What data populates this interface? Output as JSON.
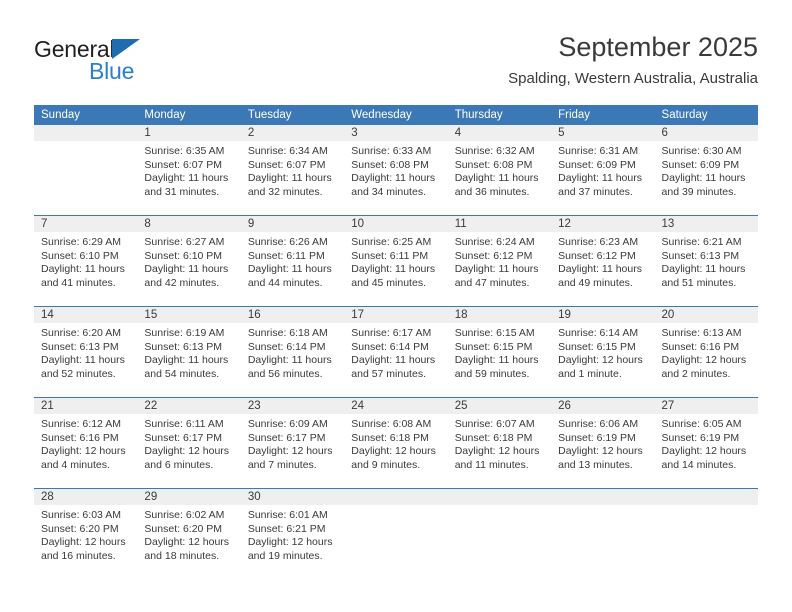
{
  "brand": {
    "name_dark": "General",
    "name_blue": "Blue",
    "triangle_icon": "blue-triangle-logo-mark",
    "accent_color": "#2980c9",
    "triangle_color": "#1f6cb0"
  },
  "header": {
    "title": "September 2025",
    "subtitle": "Spalding, Western Australia, Australia"
  },
  "calendar": {
    "header_color": "#3b78b5",
    "daynum_band_color": "#efefef",
    "weekdays": [
      "Sunday",
      "Monday",
      "Tuesday",
      "Wednesday",
      "Thursday",
      "Friday",
      "Saturday"
    ],
    "weeks": [
      [
        {
          "day": "",
          "lines": []
        },
        {
          "day": "1",
          "lines": [
            "Sunrise: 6:35 AM",
            "Sunset: 6:07 PM",
            "Daylight: 11 hours",
            "and 31 minutes."
          ]
        },
        {
          "day": "2",
          "lines": [
            "Sunrise: 6:34 AM",
            "Sunset: 6:07 PM",
            "Daylight: 11 hours",
            "and 32 minutes."
          ]
        },
        {
          "day": "3",
          "lines": [
            "Sunrise: 6:33 AM",
            "Sunset: 6:08 PM",
            "Daylight: 11 hours",
            "and 34 minutes."
          ]
        },
        {
          "day": "4",
          "lines": [
            "Sunrise: 6:32 AM",
            "Sunset: 6:08 PM",
            "Daylight: 11 hours",
            "and 36 minutes."
          ]
        },
        {
          "day": "5",
          "lines": [
            "Sunrise: 6:31 AM",
            "Sunset: 6:09 PM",
            "Daylight: 11 hours",
            "and 37 minutes."
          ]
        },
        {
          "day": "6",
          "lines": [
            "Sunrise: 6:30 AM",
            "Sunset: 6:09 PM",
            "Daylight: 11 hours",
            "and 39 minutes."
          ]
        }
      ],
      [
        {
          "day": "7",
          "lines": [
            "Sunrise: 6:29 AM",
            "Sunset: 6:10 PM",
            "Daylight: 11 hours",
            "and 41 minutes."
          ]
        },
        {
          "day": "8",
          "lines": [
            "Sunrise: 6:27 AM",
            "Sunset: 6:10 PM",
            "Daylight: 11 hours",
            "and 42 minutes."
          ]
        },
        {
          "day": "9",
          "lines": [
            "Sunrise: 6:26 AM",
            "Sunset: 6:11 PM",
            "Daylight: 11 hours",
            "and 44 minutes."
          ]
        },
        {
          "day": "10",
          "lines": [
            "Sunrise: 6:25 AM",
            "Sunset: 6:11 PM",
            "Daylight: 11 hours",
            "and 45 minutes."
          ]
        },
        {
          "day": "11",
          "lines": [
            "Sunrise: 6:24 AM",
            "Sunset: 6:12 PM",
            "Daylight: 11 hours",
            "and 47 minutes."
          ]
        },
        {
          "day": "12",
          "lines": [
            "Sunrise: 6:23 AM",
            "Sunset: 6:12 PM",
            "Daylight: 11 hours",
            "and 49 minutes."
          ]
        },
        {
          "day": "13",
          "lines": [
            "Sunrise: 6:21 AM",
            "Sunset: 6:13 PM",
            "Daylight: 11 hours",
            "and 51 minutes."
          ]
        }
      ],
      [
        {
          "day": "14",
          "lines": [
            "Sunrise: 6:20 AM",
            "Sunset: 6:13 PM",
            "Daylight: 11 hours",
            "and 52 minutes."
          ]
        },
        {
          "day": "15",
          "lines": [
            "Sunrise: 6:19 AM",
            "Sunset: 6:13 PM",
            "Daylight: 11 hours",
            "and 54 minutes."
          ]
        },
        {
          "day": "16",
          "lines": [
            "Sunrise: 6:18 AM",
            "Sunset: 6:14 PM",
            "Daylight: 11 hours",
            "and 56 minutes."
          ]
        },
        {
          "day": "17",
          "lines": [
            "Sunrise: 6:17 AM",
            "Sunset: 6:14 PM",
            "Daylight: 11 hours",
            "and 57 minutes."
          ]
        },
        {
          "day": "18",
          "lines": [
            "Sunrise: 6:15 AM",
            "Sunset: 6:15 PM",
            "Daylight: 11 hours",
            "and 59 minutes."
          ]
        },
        {
          "day": "19",
          "lines": [
            "Sunrise: 6:14 AM",
            "Sunset: 6:15 PM",
            "Daylight: 12 hours",
            "and 1 minute."
          ]
        },
        {
          "day": "20",
          "lines": [
            "Sunrise: 6:13 AM",
            "Sunset: 6:16 PM",
            "Daylight: 12 hours",
            "and 2 minutes."
          ]
        }
      ],
      [
        {
          "day": "21",
          "lines": [
            "Sunrise: 6:12 AM",
            "Sunset: 6:16 PM",
            "Daylight: 12 hours",
            "and 4 minutes."
          ]
        },
        {
          "day": "22",
          "lines": [
            "Sunrise: 6:11 AM",
            "Sunset: 6:17 PM",
            "Daylight: 12 hours",
            "and 6 minutes."
          ]
        },
        {
          "day": "23",
          "lines": [
            "Sunrise: 6:09 AM",
            "Sunset: 6:17 PM",
            "Daylight: 12 hours",
            "and 7 minutes."
          ]
        },
        {
          "day": "24",
          "lines": [
            "Sunrise: 6:08 AM",
            "Sunset: 6:18 PM",
            "Daylight: 12 hours",
            "and 9 minutes."
          ]
        },
        {
          "day": "25",
          "lines": [
            "Sunrise: 6:07 AM",
            "Sunset: 6:18 PM",
            "Daylight: 12 hours",
            "and 11 minutes."
          ]
        },
        {
          "day": "26",
          "lines": [
            "Sunrise: 6:06 AM",
            "Sunset: 6:19 PM",
            "Daylight: 12 hours",
            "and 13 minutes."
          ]
        },
        {
          "day": "27",
          "lines": [
            "Sunrise: 6:05 AM",
            "Sunset: 6:19 PM",
            "Daylight: 12 hours",
            "and 14 minutes."
          ]
        }
      ],
      [
        {
          "day": "28",
          "lines": [
            "Sunrise: 6:03 AM",
            "Sunset: 6:20 PM",
            "Daylight: 12 hours",
            "and 16 minutes."
          ]
        },
        {
          "day": "29",
          "lines": [
            "Sunrise: 6:02 AM",
            "Sunset: 6:20 PM",
            "Daylight: 12 hours",
            "and 18 minutes."
          ]
        },
        {
          "day": "30",
          "lines": [
            "Sunrise: 6:01 AM",
            "Sunset: 6:21 PM",
            "Daylight: 12 hours",
            "and 19 minutes."
          ]
        },
        {
          "day": "",
          "lines": []
        },
        {
          "day": "",
          "lines": []
        },
        {
          "day": "",
          "lines": []
        },
        {
          "day": "",
          "lines": []
        }
      ]
    ]
  }
}
